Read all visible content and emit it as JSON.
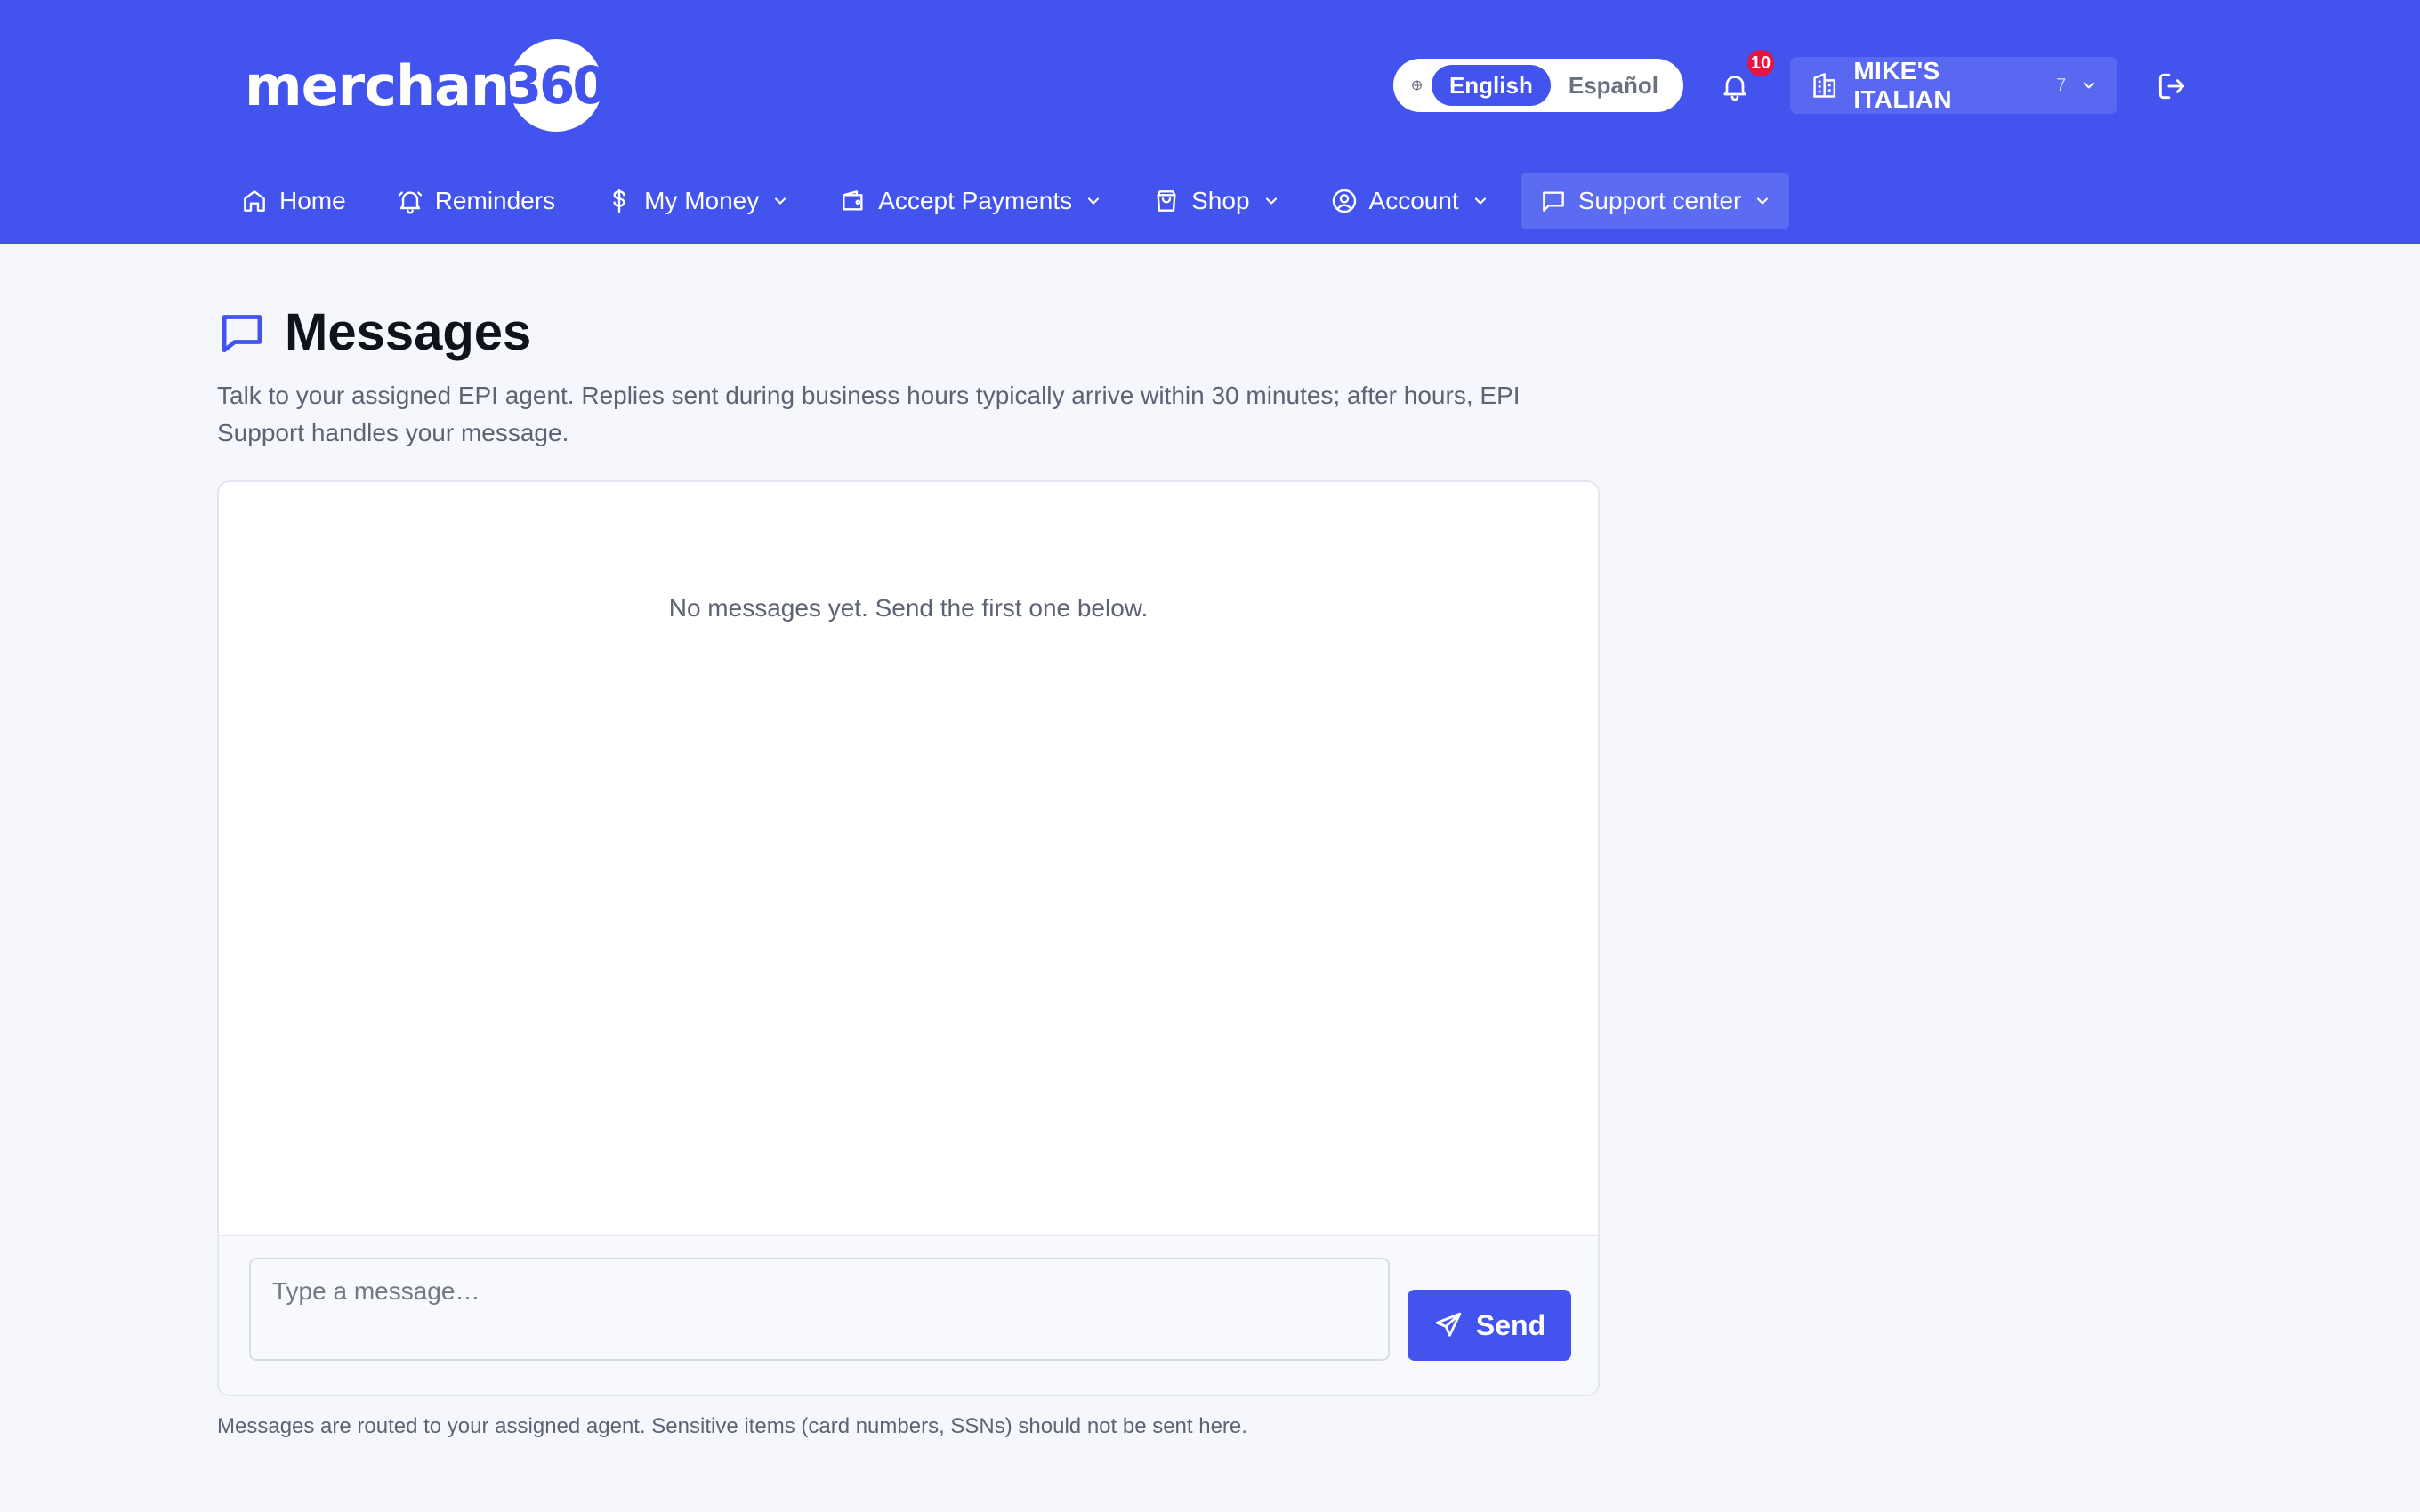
{
  "brand": {
    "logo_text": "merchant",
    "logo_number": "360"
  },
  "header": {
    "languages": [
      {
        "label": "English",
        "active": true
      },
      {
        "label": "Español",
        "active": false
      }
    ],
    "notifications_count": "10",
    "merchant": {
      "name": "MIKE'S ITALIAN",
      "count": "7"
    }
  },
  "nav": [
    {
      "label": "Home",
      "icon": "home-icon",
      "dropdown": false
    },
    {
      "label": "Reminders",
      "icon": "bell-icon",
      "dropdown": false
    },
    {
      "label": "My Money",
      "icon": "dollar-icon",
      "dropdown": true
    },
    {
      "label": "Accept Payments",
      "icon": "wallet-icon",
      "dropdown": true
    },
    {
      "label": "Shop",
      "icon": "shopping-bag-icon",
      "dropdown": true
    },
    {
      "label": "Account",
      "icon": "user-circle-icon",
      "dropdown": true
    },
    {
      "label": "Support center",
      "icon": "message-icon",
      "dropdown": true,
      "active": true
    }
  ],
  "page": {
    "title": "Messages",
    "subtitle": "Talk to your assigned EPI agent. Replies sent during business hours typically arrive within 30 minutes; after hours, EPI Support handles your message.",
    "empty_state": "No messages yet. Send the first one below.",
    "input_placeholder": "Type a message…",
    "send_label": "Send",
    "footer_note": "Messages are routed to your assigned agent. Sensitive items (card numbers, SSNs) should not be sent here."
  },
  "colors": {
    "brand_primary": "#4254ed",
    "notification_badge": "#e8143f",
    "page_background": "#f5f7fc"
  }
}
